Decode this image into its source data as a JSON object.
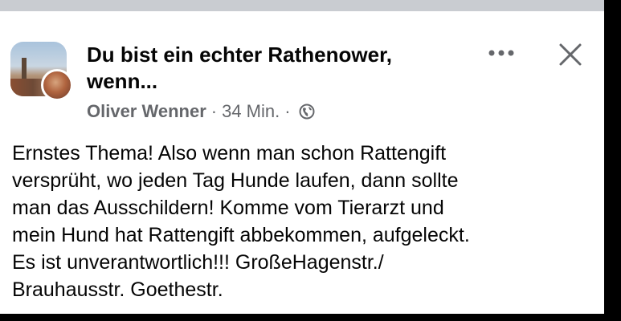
{
  "post": {
    "group_name_line1": "Du bist ein echter Rathenower,",
    "group_name_line2": "wenn...",
    "author": "Oliver Wenner",
    "time": "34 Min.",
    "separator": "·",
    "privacy_icon": "globe-icon",
    "more_icon": "more-dots-icon",
    "close_icon": "close-icon",
    "body_lines": [
      "Ernstes Thema! Also wenn man schon Rattengift",
      "versprüht, wo jeden Tag Hunde laufen, dann sollte",
      "man das Ausschildern! Komme vom Tierarzt und",
      "mein Hund hat Rattengift abbekommen, aufgeleckt.",
      "Es ist unverantwortlich!!! GroßeHagenstr./",
      "Brauhausstr. Goethestr."
    ]
  },
  "colors": {
    "text_primary": "#050505",
    "text_secondary": "#65676b",
    "background": "#ffffff",
    "top_bar": "#c9ccd1"
  }
}
